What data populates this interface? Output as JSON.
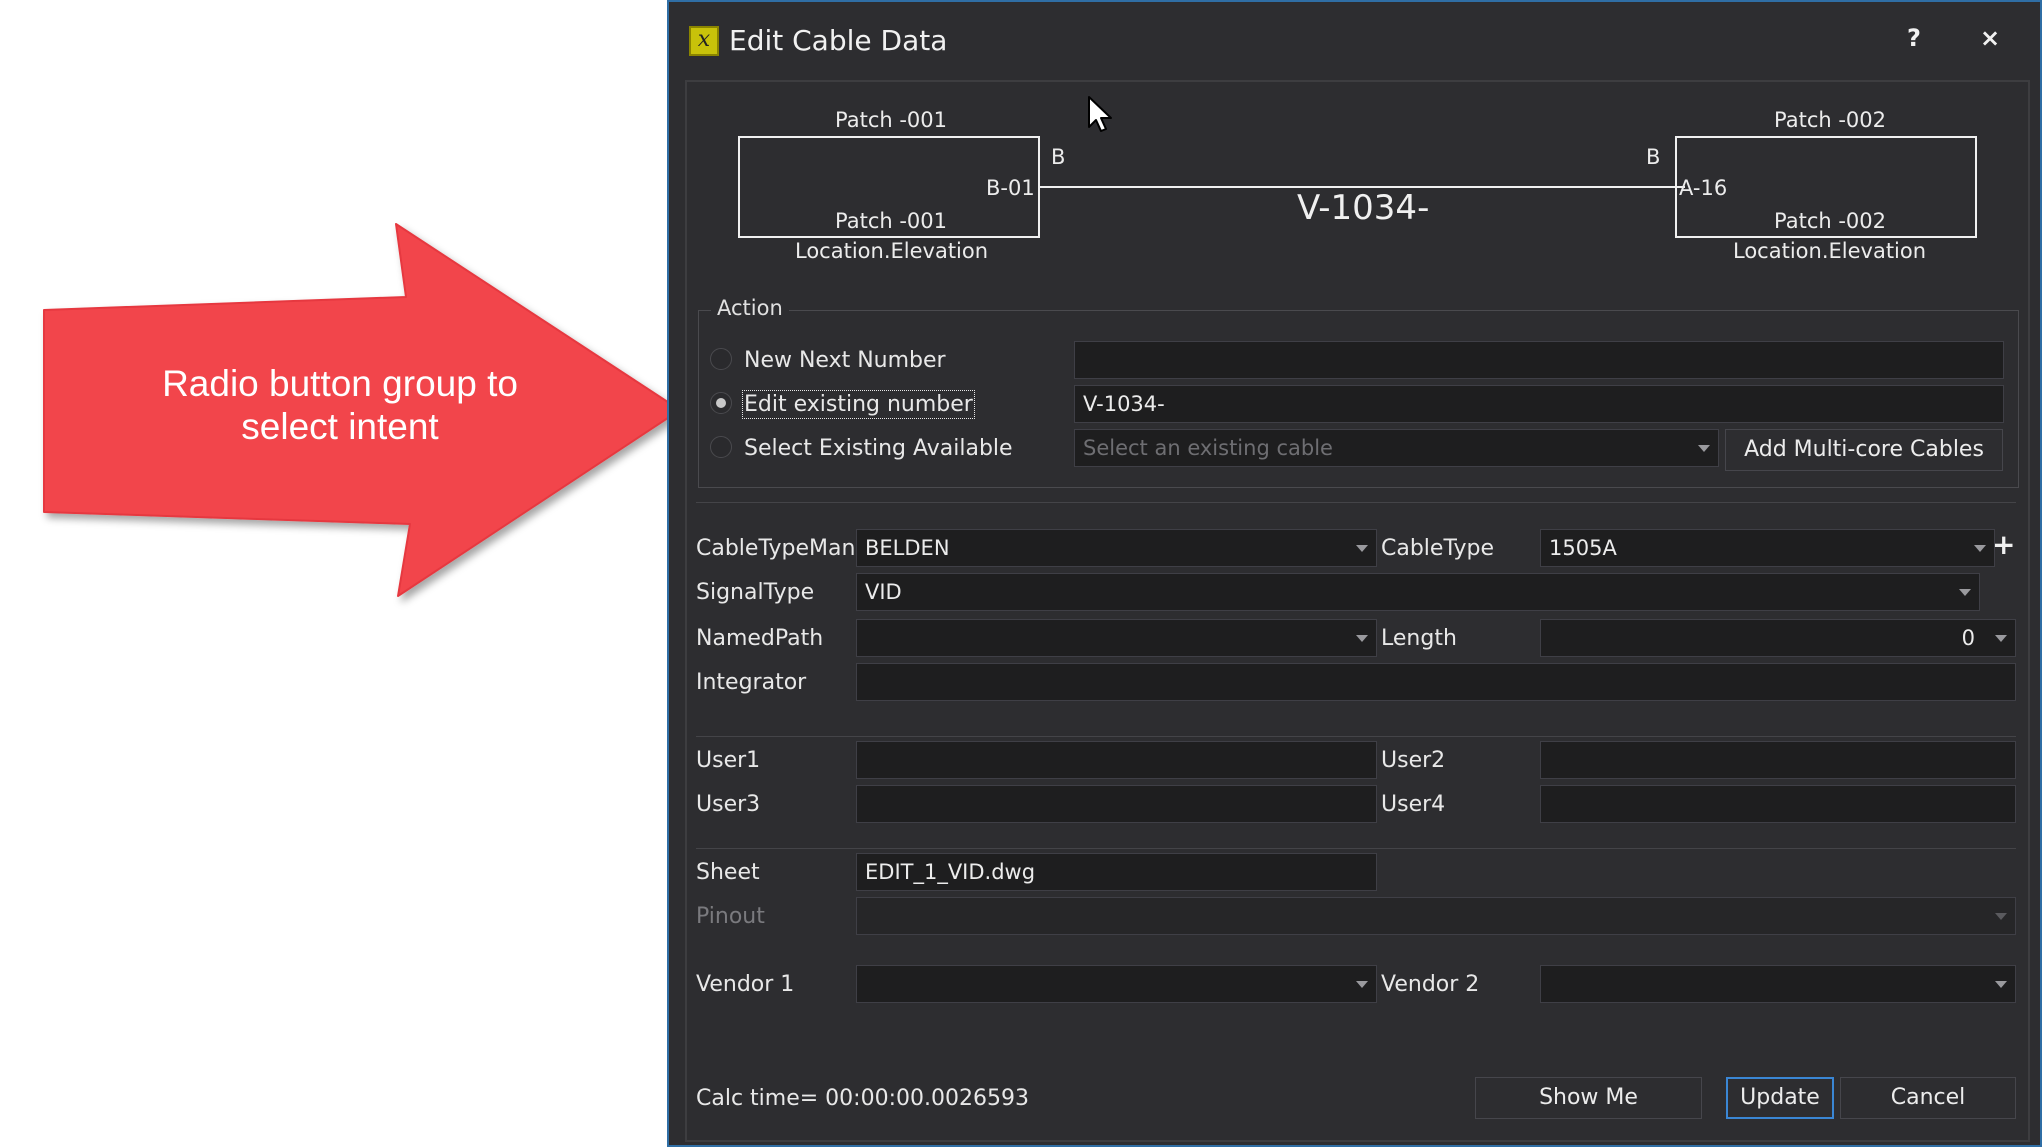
{
  "callout": {
    "text_line1": "Radio button group to",
    "text_line2": "select intent",
    "color": "#f2454b"
  },
  "dialog": {
    "title": "Edit Cable Data",
    "app_icon": "xl-app-icon",
    "help_label": "?",
    "close_label": "×",
    "accent": "#2f6ea5"
  },
  "diagram": {
    "left_top": "Patch -001",
    "left_port": "B-01",
    "left_inner": "Patch -001",
    "left_location": "Location.Elevation",
    "left_side": "B",
    "right_top": "Patch -002",
    "right_port": "A-16",
    "right_inner": "Patch -002",
    "right_location": "Location.Elevation",
    "right_side": "B",
    "cable_id": "V-1034-"
  },
  "action": {
    "title": "Action",
    "options": [
      {
        "label": "New Next Number",
        "checked": false
      },
      {
        "label": "Edit existing number",
        "checked": true
      },
      {
        "label": "Select Existing Available",
        "checked": false
      }
    ],
    "new_next_value": "",
    "edit_value": "V-1034-",
    "existing_cable_placeholder": "Select an existing cable",
    "add_multicore_label": "Add Multi-core Cables"
  },
  "fields": {
    "cable_type_manu_label": "CableTypeManu",
    "cable_type_manu_value": "BELDEN",
    "cable_type_label": "CableType",
    "cable_type_value": "1505A",
    "add_type_label": "+",
    "signal_type_label": "SignalType",
    "signal_type_value": "VID",
    "named_path_label": "NamedPath",
    "named_path_value": "",
    "length_label": "Length",
    "length_value": "0",
    "integrator_label": "Integrator",
    "integrator_value": "",
    "user1_label": "User1",
    "user1_value": "",
    "user2_label": "User2",
    "user2_value": "",
    "user3_label": "User3",
    "user3_value": "",
    "user4_label": "User4",
    "user4_value": "",
    "sheet_label": "Sheet",
    "sheet_value": "EDIT_1_VID.dwg",
    "pinout_label": "Pinout",
    "pinout_value": "",
    "vendor1_label": "Vendor 1",
    "vendor1_value": "",
    "vendor2_label": "Vendor 2",
    "vendor2_value": ""
  },
  "footer": {
    "calc_time": "Calc time= 00:00:00.0026593",
    "show_me_label": "Show Me",
    "update_label": "Update",
    "cancel_label": "Cancel"
  }
}
